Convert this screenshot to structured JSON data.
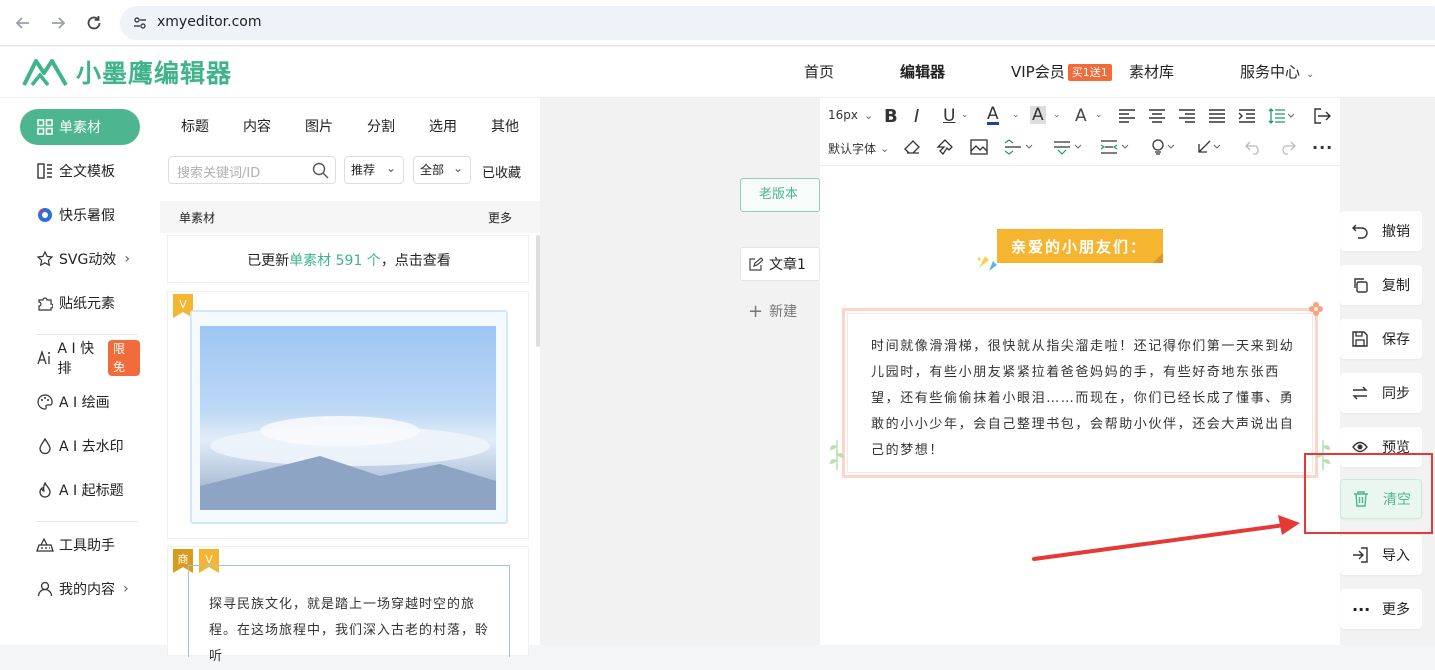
{
  "browser": {
    "url": "xmyeditor.com"
  },
  "site": {
    "logo_text": "小墨鹰编辑器",
    "nav": {
      "home": "首页",
      "editor": "编辑器",
      "vip": "VIP会员",
      "vip_badge": "买1送1",
      "materials": "素材库",
      "service": "服务中心"
    }
  },
  "leftnav": {
    "items": [
      {
        "label": "单素材",
        "icon": "grid-icon"
      },
      {
        "label": "全文模板",
        "icon": "template-icon"
      },
      {
        "label": "快乐暑假",
        "icon": "ball-icon"
      },
      {
        "label": "SVG动效",
        "icon": "star-icon"
      },
      {
        "label": "贴纸元素",
        "icon": "puzzle-icon"
      },
      {
        "label": "A I 快排",
        "icon": "ai-icon",
        "badge": "限免"
      },
      {
        "label": "A I 绘画",
        "icon": "palette-icon"
      },
      {
        "label": "A I 去水印",
        "icon": "drop-icon"
      },
      {
        "label": "A I 起标题",
        "icon": "fire-icon"
      },
      {
        "label": "工具助手",
        "icon": "tool-icon"
      },
      {
        "label": "我的内容",
        "icon": "user-icon"
      }
    ]
  },
  "materials": {
    "tabs": [
      "标题",
      "内容",
      "图片",
      "分割",
      "选用",
      "其他"
    ],
    "search_placeholder": "搜索关键词/ID",
    "filter_sort": "推荐",
    "filter_range": "全部",
    "favorites": "已收藏",
    "section_title": "单素材",
    "section_more": "更多",
    "update_prefix": "已更新",
    "update_link": "单素材 591 个",
    "update_suffix": "，点击查看",
    "badge_v": "V",
    "badge_shang": "商",
    "card2_text": "探寻民族文化，就是踏上一场穿越时空的旅程。在这场旅程中，我们深入古老的村落，聆听"
  },
  "canvas": {
    "old_version": "老版本",
    "doc_tab": "文章1",
    "new_doc": "新建"
  },
  "toolbar": {
    "font_size": "16px",
    "font_family": "默认字体"
  },
  "editor_content": {
    "title": "亲爱的小朋友们：",
    "body": "时间就像滑滑梯，很快就从指尖溜走啦！还记得你们第一天来到幼儿园时，有些小朋友紧紧拉着爸爸妈妈的手，有些好奇地东张西望，还有些偷偷抹着小眼泪……而现在，你们已经长成了懂事、勇敢的小小少年，会自己整理书包，会帮助小伙伴，还会大声说出自己的梦想！"
  },
  "side_actions": {
    "undo": "撤销",
    "copy": "复制",
    "save": "保存",
    "sync": "同步",
    "preview": "预览",
    "clear": "清空",
    "import": "导入",
    "more": "更多"
  },
  "colors": {
    "brand": "#4db691",
    "annotation": "#e53935",
    "title_bg": "#f5b531",
    "frame": "#fcd5c8"
  }
}
